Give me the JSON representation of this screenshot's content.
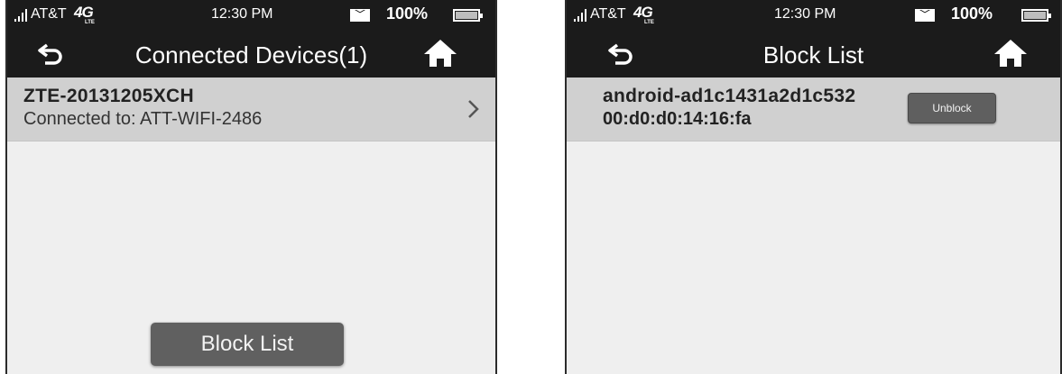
{
  "left": {
    "status": {
      "carrier": "AT&T",
      "network": "4G",
      "network_sub": "LTE",
      "time": "12:30 PM",
      "battery": "100%"
    },
    "title": "Connected Devices(1)",
    "device": {
      "name": "ZTE-20131205XCH",
      "connection": "Connected to: ATT-WIFI-2486"
    },
    "block_list_button": "Block List"
  },
  "right": {
    "status": {
      "carrier": "AT&T",
      "network": "4G",
      "network_sub": "LTE",
      "time": "12:30 PM",
      "battery": "100%"
    },
    "title": "Block List",
    "device": {
      "name": "android-ad1c1431a2d1c532",
      "mac": "00:d0:d0:14:16:fa"
    },
    "unblock_button": "Unblock"
  },
  "icons": {
    "back": "back-arrow-icon",
    "home": "home-icon",
    "chevron": "chevron-right-icon",
    "mail": "mail-icon",
    "battery": "battery-icon",
    "signal": "signal-icon"
  },
  "colors": {
    "bar_background": "#1b1b1b",
    "row_background": "#d0d0d0",
    "button_background": "#606060"
  }
}
